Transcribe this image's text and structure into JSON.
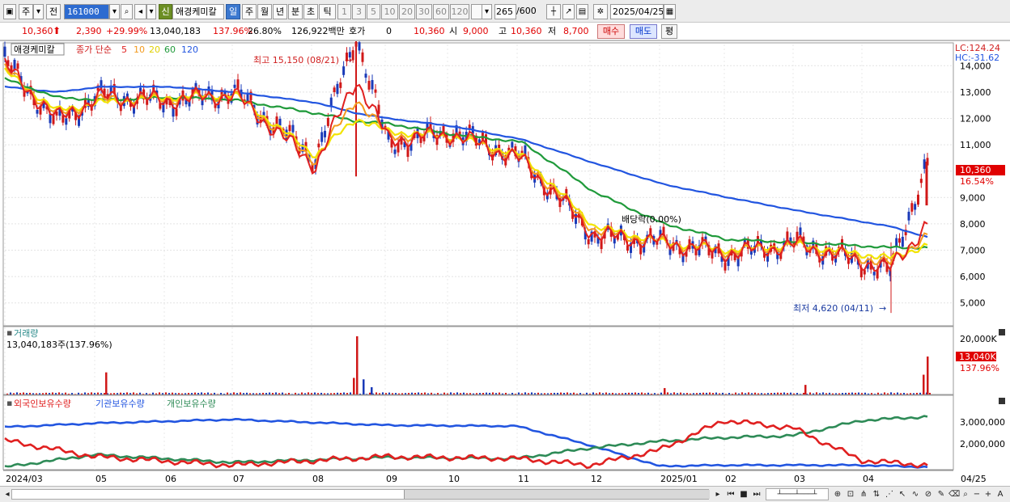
{
  "toolbar": {
    "period_label": "주",
    "prev_label": "전",
    "stock_code": "161000",
    "sin_badge": "신",
    "stock_name": "애경케미칼",
    "tabs": [
      "일",
      "주",
      "월",
      "년",
      "분",
      "초",
      "틱"
    ],
    "selected_tab": "일",
    "intervals": [
      "1",
      "3",
      "5",
      "10",
      "20",
      "30",
      "60",
      "120"
    ],
    "count": "265",
    "count_total": "/600",
    "date": "2025/04/25"
  },
  "price_bar": {
    "price": "10,360",
    "change": "2,390",
    "change_pct": "+29.99%",
    "volume": "13,040,183",
    "volume_ratio": "137.96%",
    "turnover": "26.80%",
    "amount": "126,922백만",
    "quote_label": "호가",
    "quote_value": "0",
    "quote_price": "10,360",
    "open_label": "시",
    "open": "9,000",
    "high_label": "고",
    "high": "10,360",
    "low_label": "저",
    "low": "8,700",
    "buy_label": "매수",
    "sell_label": "매도",
    "eval_label": "평"
  },
  "price_panel": {
    "stock_label": "애경케미칼",
    "legend_prefix": "종가 단순",
    "ma_periods": [
      "5",
      "10",
      "20",
      "60",
      "120"
    ],
    "ma_colors": [
      "#e02020",
      "#f39a1e",
      "#f2e400",
      "#1f9a3a",
      "#2255e0"
    ],
    "lc_label": "LC:124.24",
    "hc_label": "HC:-31.62",
    "high_annotation": "최고 15,150 (08/21)",
    "low_annotation": "최저 4,620 (04/11)",
    "dividend_annotation": "배당락(0.00%)",
    "last_price_label": "10,360",
    "last_pct_label": "16.54%",
    "y_ticks": [
      "14,000",
      "13,000",
      "12,000",
      "11,000",
      "10,000",
      "9,000",
      "8,000",
      "7,000",
      "6,000",
      "5,000"
    ]
  },
  "volume_panel": {
    "title": "거래량",
    "value": "13,040,183주(137.96%)",
    "y_tick": "20,000K",
    "last_label": "13,040K",
    "last_pct_label": "137.96%"
  },
  "holding_panel": {
    "legend": [
      "외국인보유수량",
      "기관보유수량",
      "개인보유수량"
    ],
    "legend_colors": [
      "#e02020",
      "#2255e0",
      "#2e8b57"
    ],
    "y_ticks": [
      "3,000,000",
      "2,000,000"
    ]
  },
  "x_axis": {
    "labels": [
      "2024/03",
      "05",
      "06",
      "07",
      "08",
      "09",
      "10",
      "11",
      "12",
      "2025/01",
      "02",
      "03",
      "04",
      "04/25"
    ]
  },
  "chart_data": {
    "type": "line",
    "x": [
      "2024/03",
      "2024/04",
      "2024/05",
      "2024/06",
      "2024/07",
      "2024/08",
      "2024/08/21",
      "2024/09",
      "2024/10",
      "2024/11",
      "2024/12",
      "2025/01",
      "2025/02",
      "2025/03",
      "2025/04/11",
      "2025/04/25"
    ],
    "series": [
      {
        "name": "종가",
        "values": [
          14200,
          11800,
          12900,
          12600,
          13000,
          10500,
          15150,
          11000,
          11500,
          10500,
          7500,
          7300,
          6800,
          7300,
          6200,
          10360
        ]
      },
      {
        "name": "5",
        "values": [
          14000,
          12000,
          12800,
          12700,
          12900,
          10200,
          13500,
          11200,
          11400,
          10400,
          7600,
          7300,
          6900,
          7200,
          6300,
          8000
        ]
      },
      {
        "name": "20",
        "values": [
          13800,
          12300,
          12600,
          12800,
          12900,
          10600,
          12000,
          11500,
          11300,
          10600,
          7900,
          7300,
          7000,
          7200,
          6700,
          7200
        ]
      },
      {
        "name": "60",
        "values": [
          13500,
          12800,
          12700,
          12800,
          12700,
          12200,
          11900,
          11800,
          11400,
          11100,
          9200,
          8000,
          7400,
          7300,
          7100,
          7100
        ]
      },
      {
        "name": "120",
        "values": [
          13200,
          13000,
          13200,
          13200,
          13000,
          12600,
          12200,
          12000,
          11700,
          11200,
          10300,
          9500,
          9000,
          8500,
          7900,
          7500
        ]
      }
    ],
    "volume_k": {
      "peak": 20000,
      "last": 13040
    },
    "y_range": [
      4500,
      14500
    ],
    "holdings": {
      "x": [
        "2024/03",
        "2024/05",
        "2024/07",
        "2024/09",
        "2024/11",
        "2024/12",
        "2025/01",
        "2025/02",
        "2025/03",
        "2025/04",
        "2025/04/25"
      ],
      "series": [
        {
          "name": "외국인보유수량",
          "values": [
            2450000,
            1600000,
            1150000,
            1600000,
            1500000,
            1150000,
            1950000,
            3500000,
            3100000,
            1400000,
            1150000
          ]
        },
        {
          "name": "기관보유수량",
          "values": [
            3150000,
            3350000,
            3550000,
            3250000,
            3200000,
            2200000,
            1100000,
            1150000,
            1150000,
            1150000,
            1050000
          ]
        },
        {
          "name": "개인보유수량",
          "values": [
            1050000,
            1700000,
            1300000,
            1550000,
            1500000,
            2050000,
            2400000,
            2600000,
            2700000,
            3500000,
            3700000
          ]
        }
      ]
    }
  }
}
